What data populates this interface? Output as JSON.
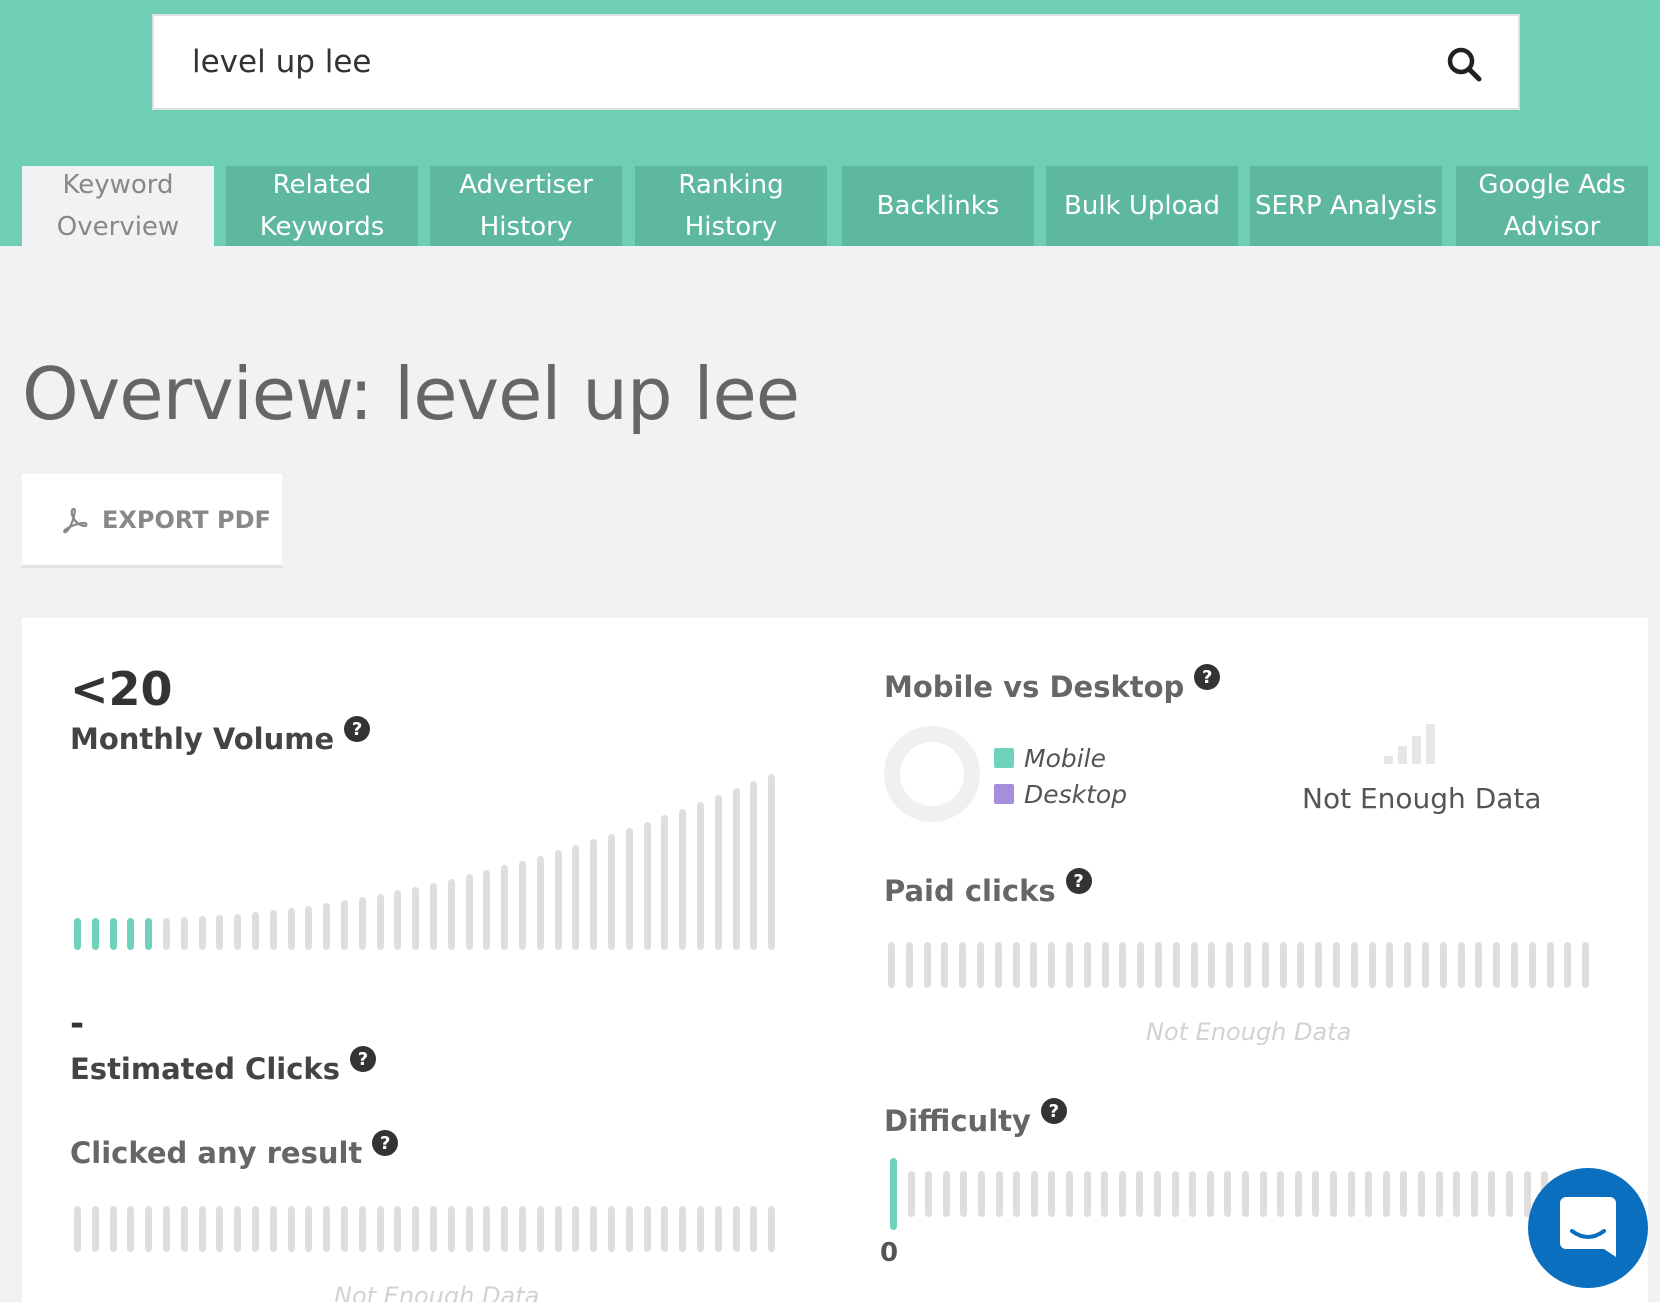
{
  "search": {
    "value": "level up lee"
  },
  "tabs": [
    {
      "line1": "Keyword",
      "line2": "Overview",
      "active": true
    },
    {
      "line1": "Related",
      "line2": "Keywords"
    },
    {
      "line1": "Advertiser",
      "line2": "History"
    },
    {
      "line1": "Ranking",
      "line2": "History"
    },
    {
      "line1": "Backlinks",
      "line2": ""
    },
    {
      "line1": "Bulk Upload",
      "line2": ""
    },
    {
      "line1": "SERP Analysis",
      "line2": ""
    },
    {
      "line1": "Google Ads",
      "line2": "Advisor"
    }
  ],
  "page_title": "Overview: level up lee",
  "export_label": "EXPORT PDF",
  "monthly_volume": {
    "value": "<20",
    "label": "Monthly Volume"
  },
  "estimated_clicks": {
    "value": "-",
    "label": "Estimated Clicks"
  },
  "clicked_any_result": {
    "label": "Clicked any result",
    "status": "Not Enough Data"
  },
  "mobile_vs_desktop": {
    "label": "Mobile vs Desktop",
    "legend": [
      "Mobile",
      "Desktop"
    ],
    "status": "Not Enough Data"
  },
  "paid_clicks": {
    "label": "Paid clicks",
    "status": "Not Enough Data"
  },
  "difficulty": {
    "label": "Difficulty",
    "value": "0"
  },
  "colors": {
    "accent": "#6fd3bb",
    "desktop": "#a58fdd",
    "header": "#6fcfb4",
    "chat": "#0a6fbf"
  },
  "icons": [
    "search-icon",
    "pdf-icon",
    "help-icon",
    "signal-icon",
    "chat-icon"
  ],
  "chart_data": [
    {
      "type": "bar",
      "name_context": "Monthly Volume",
      "highlighted_bars": 5,
      "total_bars": 40,
      "ylim": [
        0,
        1
      ]
    }
  ]
}
